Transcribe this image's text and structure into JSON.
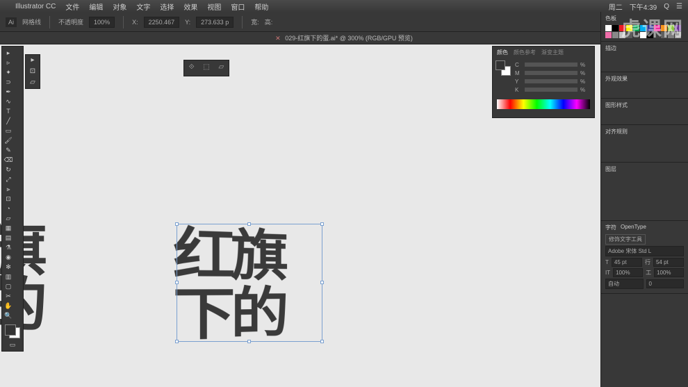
{
  "menubar": {
    "app": "Illustrator CC",
    "items": [
      "文件",
      "编辑",
      "对象",
      "文字",
      "选择",
      "效果",
      "视图",
      "窗口",
      "帮助"
    ],
    "right": {
      "day": "周二",
      "time": "下午4:39"
    }
  },
  "optionbar": {
    "label1": "网格线",
    "opacity_label": "不透明度",
    "opacity": "100%",
    "x_label": "X:",
    "x": "2250.467",
    "y_label": "Y:",
    "y": "273.633 p",
    "w_label": "宽:",
    "h_label": "高:"
  },
  "document": {
    "title": "029-红旗下的蛋.ai* @ 300% (RGB/GPU 预览)"
  },
  "color_panel": {
    "tabs": [
      "颜色",
      "颜色参考",
      "渐变主题"
    ],
    "channels": [
      {
        "label": "C",
        "value": "%"
      },
      {
        "label": "M",
        "value": "%"
      },
      {
        "label": "Y",
        "value": "%"
      },
      {
        "label": "K",
        "value": "%"
      }
    ]
  },
  "right_panels": {
    "swatches_tab": "色板",
    "swatch_colors": [
      "#ffffff",
      "#000000",
      "#ed1c24",
      "#fff200",
      "#00a651",
      "#00aeef",
      "#2e3192",
      "#ec008c",
      "#f7941d",
      "#8dc63e",
      "#662d91",
      "#f06eaa",
      "#898989",
      "#c0c0c0",
      "#5b5b5b",
      "#3b3b3b",
      "#ffffff",
      "#000000",
      "#404040",
      "#606060",
      "#808080",
      "#a0a0a0"
    ],
    "stroke_tab": "描边",
    "appearance": "外观效果",
    "graphic_styles": "图形样式",
    "align": "对齐规则",
    "layers": "图层",
    "char": {
      "tab": "字符",
      "touch_type": "修饰文字工具",
      "font": "Adobe 宋体 Std L",
      "size_label": "T",
      "size": "45 pt",
      "leading_label": "行",
      "leading": "54 pt",
      "tracking_label": "IT",
      "tracking": "100%",
      "scale_label": "工",
      "scale": "100%",
      "va1": "自动",
      "va2": "0"
    }
  },
  "canvas": {
    "text_left_l1": "旗",
    "text_left_l2": "的",
    "text_main_l1": "红旗",
    "text_main_l2": "下的"
  },
  "watermark": "虎课网"
}
